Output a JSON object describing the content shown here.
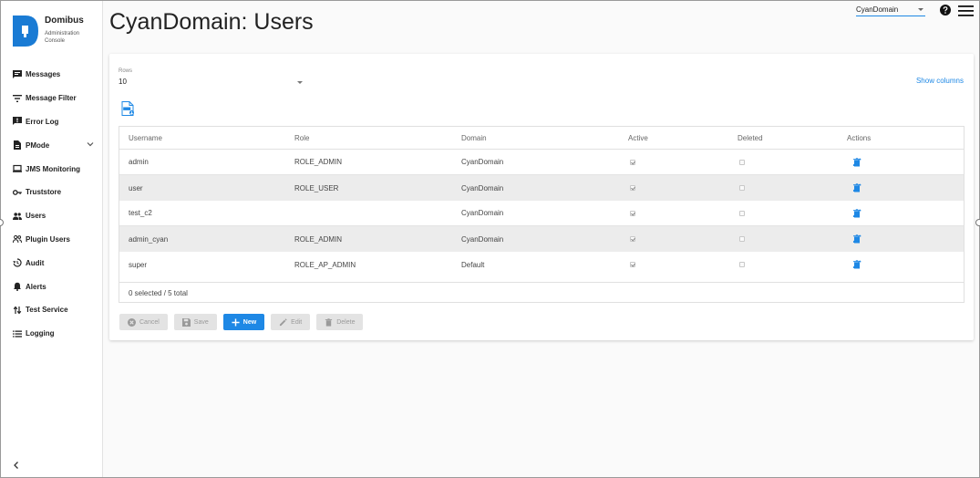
{
  "brand": {
    "name": "Domibus",
    "subtitle": "Administration Console"
  },
  "sidebar": {
    "items": [
      {
        "label": "Messages",
        "icon": "message-icon"
      },
      {
        "label": "Message Filter",
        "icon": "filter-icon"
      },
      {
        "label": "Error Log",
        "icon": "error-log-icon"
      },
      {
        "label": "PMode",
        "icon": "document-icon",
        "expandable": true
      },
      {
        "label": "JMS Monitoring",
        "icon": "laptop-icon"
      },
      {
        "label": "Truststore",
        "icon": "key-icon"
      },
      {
        "label": "Users",
        "icon": "users-icon"
      },
      {
        "label": "Plugin Users",
        "icon": "plugin-users-icon"
      },
      {
        "label": "Audit",
        "icon": "history-icon"
      },
      {
        "label": "Alerts",
        "icon": "bell-icon"
      },
      {
        "label": "Test Service",
        "icon": "swap-icon"
      },
      {
        "label": "Logging",
        "icon": "list-icon"
      }
    ]
  },
  "header": {
    "title": "CyanDomain: Users",
    "domain_selected": "CyanDomain"
  },
  "card": {
    "rows_label": "Rows",
    "rows_value": "10",
    "show_columns": "Show columns"
  },
  "table": {
    "columns": [
      "Username",
      "Role",
      "Domain",
      "Active",
      "Deleted",
      "Actions"
    ],
    "rows": [
      {
        "username": "admin",
        "role": "ROLE_ADMIN",
        "domain": "CyanDomain",
        "active": true,
        "deleted": false
      },
      {
        "username": "user",
        "role": "ROLE_USER",
        "domain": "CyanDomain",
        "active": true,
        "deleted": false
      },
      {
        "username": "test_c2",
        "role": "",
        "domain": "CyanDomain",
        "active": true,
        "deleted": false
      },
      {
        "username": "admin_cyan",
        "role": "ROLE_ADMIN",
        "domain": "CyanDomain",
        "active": true,
        "deleted": false
      },
      {
        "username": "super",
        "role": "ROLE_AP_ADMIN",
        "domain": "Default",
        "active": true,
        "deleted": false
      }
    ],
    "footer": "0 selected / 5 total"
  },
  "buttons": {
    "cancel": "Cancel",
    "save": "Save",
    "new": "New",
    "edit": "Edit",
    "delete": "Delete"
  },
  "colors": {
    "accent": "#1e88e5",
    "brand": "#1a7bd4"
  }
}
